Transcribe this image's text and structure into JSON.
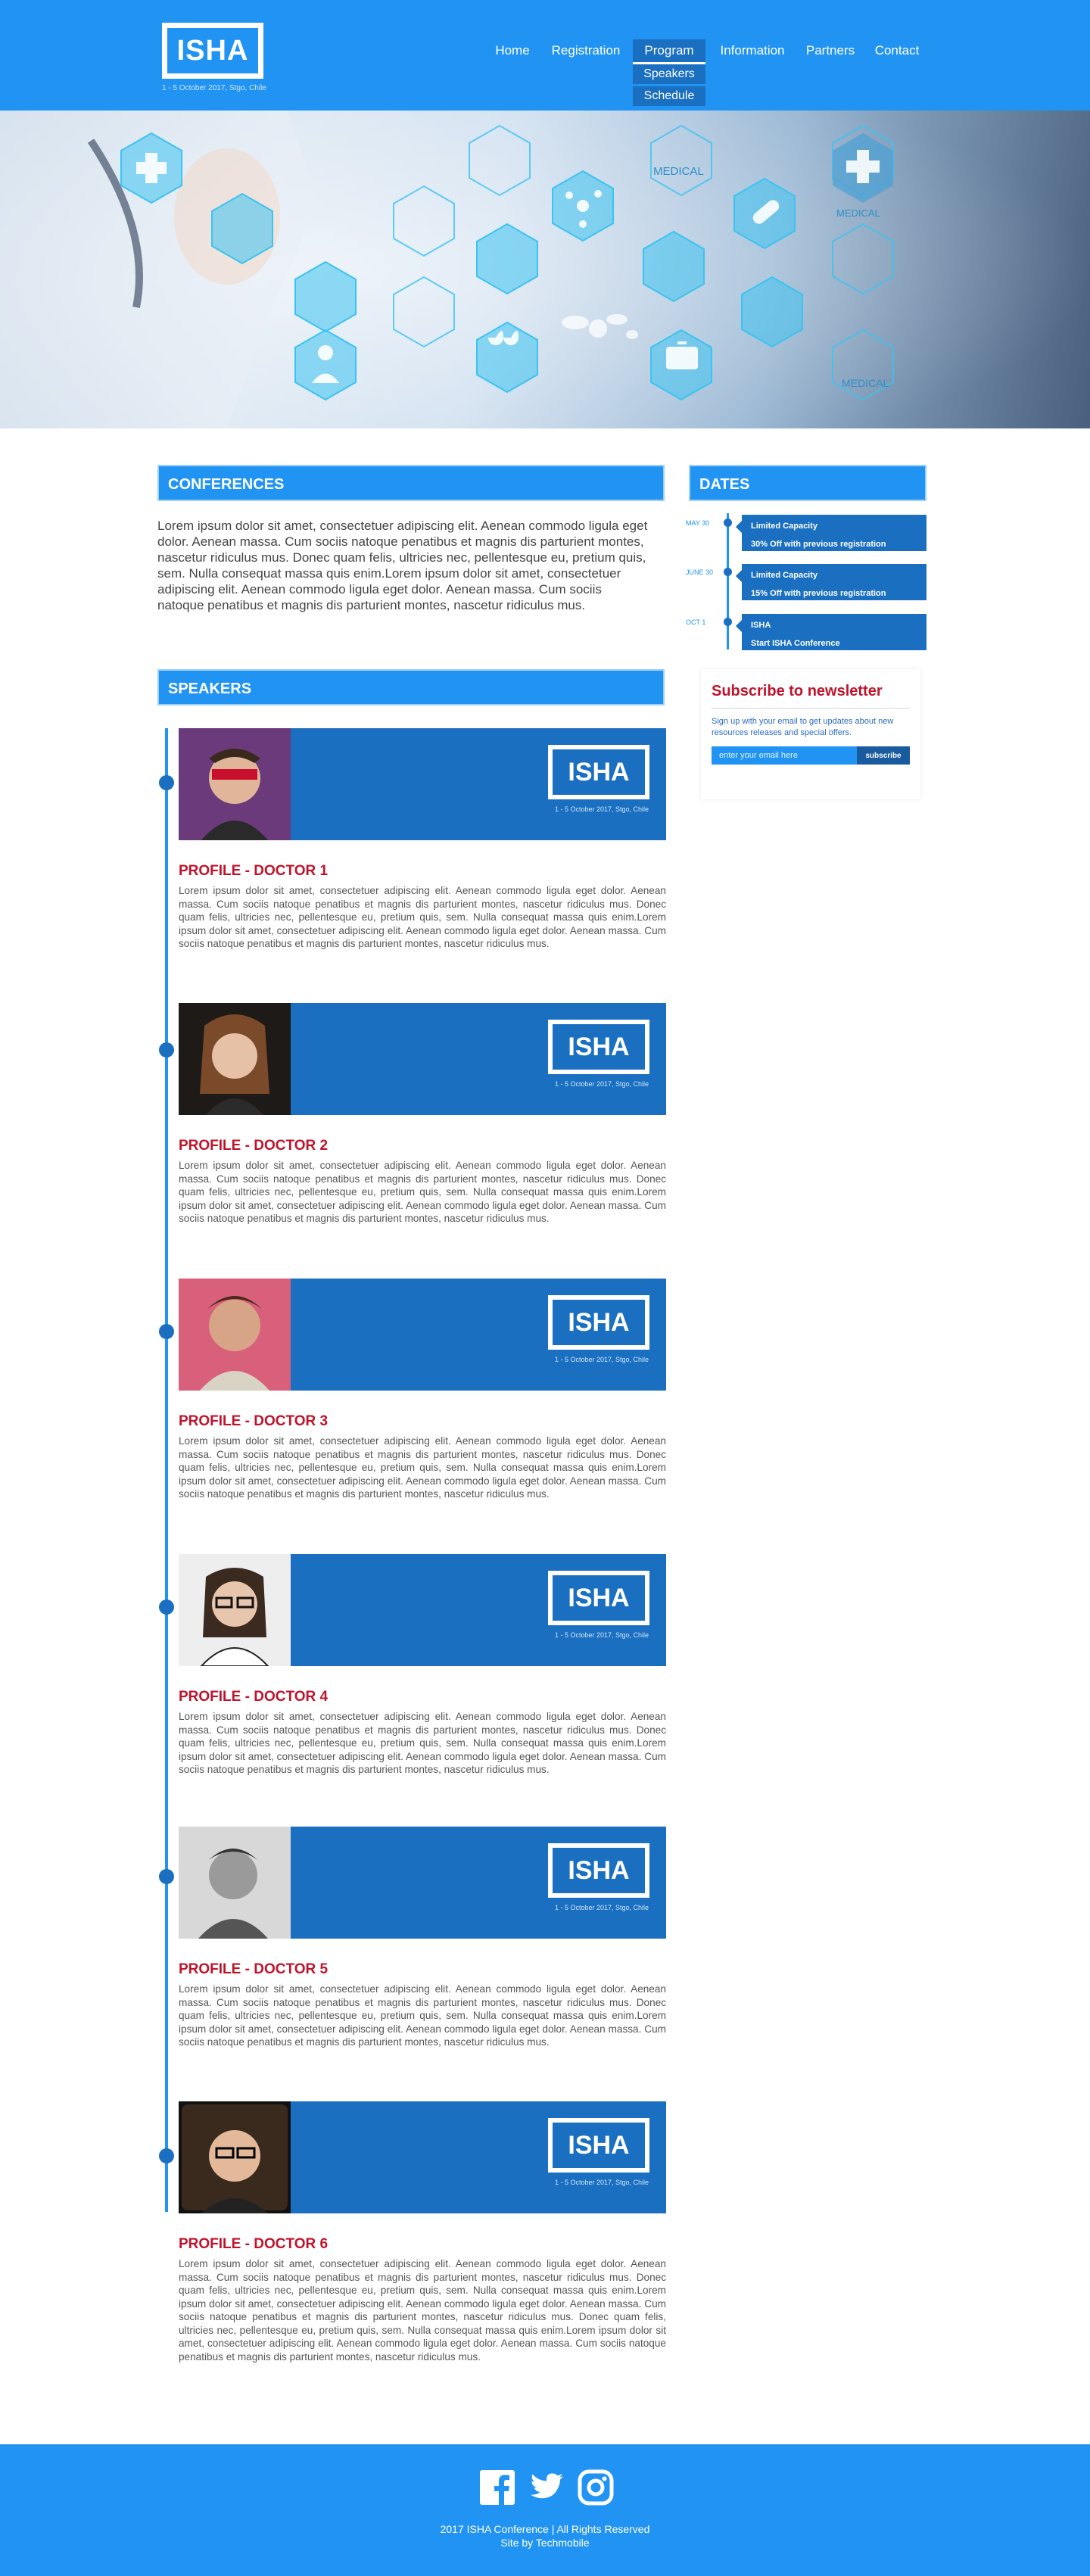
{
  "header": {
    "logo": "ISHA",
    "logo_subtitle": "1 - 5 October 2017, Stgo, Chile",
    "nav": [
      {
        "label": "Home"
      },
      {
        "label": "Registration"
      },
      {
        "label": "Program",
        "active": true
      },
      {
        "label": "Information"
      },
      {
        "label": "Partners"
      },
      {
        "label": "Contact"
      }
    ],
    "program_submenu": [
      "Speakers",
      "Schedule"
    ]
  },
  "hero": {
    "labels": [
      "MEDICAL",
      "MEDICAL",
      "MEDICAL"
    ],
    "icons": [
      "medical-cross-icon",
      "stethoscope-icon",
      "molecule-icon",
      "pill-icon",
      "test-tubes-icon",
      "microscope-icon",
      "syringe-icon",
      "first-aid-kit-icon",
      "doctor-icon",
      "wheelchair-icon",
      "blood-drops-icon",
      "world-map-icon"
    ]
  },
  "conferences": {
    "title": "CONFERENCES",
    "text": "Lorem ipsum dolor sit amet, consectetuer adipiscing elit. Aenean commodo ligula eget dolor. Aenean massa. Cum sociis natoque penatibus et magnis dis parturient montes, nascetur ridiculus mus. Donec quam felis, ultricies nec, pellentesque eu, pretium quis, sem. Nulla consequat massa quis enim.Lorem ipsum dolor sit amet, consectetuer adipiscing elit. Aenean commodo ligula eget dolor. Aenean massa. Cum sociis natoque penatibus et magnis dis parturient montes, nascetur ridiculus mus."
  },
  "dates": {
    "title": "DATES",
    "items": [
      {
        "date": "MAY 30",
        "line1": "Limited Capacity",
        "line2": "30% Off with previous registration"
      },
      {
        "date": "JUNE 30",
        "line1": "Limited Capacity",
        "line2": "15% Off with previous registration"
      },
      {
        "date": "OCT 1",
        "line1": "ISHA",
        "line2": "Start ISHA Conference"
      }
    ]
  },
  "newsletter": {
    "title": "Subscribe to newsletter",
    "description": "Sign up with your email to get updates about new resources releases and special offers.",
    "placeholder": "enter your email here",
    "button": "subscribe"
  },
  "speakers": {
    "title": "SPEAKERS",
    "banner_logo": "ISHA",
    "banner_subtitle": "1 - 5 October 2017, Stgo, Chile",
    "items": [
      {
        "name": "PROFILE - DOCTOR 1",
        "bio": "Lorem ipsum dolor sit amet, consectetuer adipiscing elit. Aenean commodo ligula eget dolor. Aenean massa. Cum sociis natoque penatibus et magnis dis parturient montes, nascetur ridiculus mus. Donec quam felis, ultricies nec, pellentesque eu, pretium quis, sem. Nulla consequat massa quis enim.Lorem ipsum dolor sit amet, consectetuer adipiscing elit. Aenean commodo ligula eget dolor. Aenean massa. Cum sociis natoque penatibus et magnis dis parturient montes, nascetur ridiculus mus."
      },
      {
        "name": "PROFILE - DOCTOR 2",
        "bio": "Lorem ipsum dolor sit amet, consectetuer adipiscing elit. Aenean commodo ligula eget dolor. Aenean massa. Cum sociis natoque penatibus et magnis dis parturient montes, nascetur ridiculus mus. Donec quam felis, ultricies nec, pellentesque eu, pretium quis, sem. Nulla consequat massa quis enim.Lorem ipsum dolor sit amet, consectetuer adipiscing elit. Aenean commodo ligula eget dolor. Aenean massa. Cum sociis natoque penatibus et magnis dis parturient montes, nascetur ridiculus mus."
      },
      {
        "name": "PROFILE - DOCTOR 3",
        "bio": "Lorem ipsum dolor sit amet, consectetuer adipiscing elit. Aenean commodo ligula eget dolor. Aenean massa. Cum sociis natoque penatibus et magnis dis parturient montes, nascetur ridiculus mus. Donec quam felis, ultricies nec, pellentesque eu, pretium quis, sem. Nulla consequat massa quis enim.Lorem ipsum dolor sit amet, consectetuer adipiscing elit. Aenean commodo ligula eget dolor. Aenean massa. Cum sociis natoque penatibus et magnis dis parturient montes, nascetur ridiculus mus."
      },
      {
        "name": "PROFILE - DOCTOR 4",
        "bio": "Lorem ipsum dolor sit amet, consectetuer adipiscing elit. Aenean commodo ligula eget dolor. Aenean massa. Cum sociis natoque penatibus et magnis dis parturient montes, nascetur ridiculus mus. Donec quam felis, ultricies nec, pellentesque eu, pretium quis, sem. Nulla consequat massa quis enim.Lorem ipsum dolor sit amet, consectetuer adipiscing elit. Aenean commodo ligula eget dolor. Aenean massa. Cum sociis natoque penatibus et magnis dis parturient montes, nascetur ridiculus mus."
      },
      {
        "name": "PROFILE - DOCTOR 5",
        "bio": "Lorem ipsum dolor sit amet, consectetuer adipiscing elit. Aenean commodo ligula eget dolor. Aenean massa. Cum sociis natoque penatibus et magnis dis parturient montes, nascetur ridiculus mus. Donec quam felis, ultricies nec, pellentesque eu, pretium quis, sem. Nulla consequat massa quis enim.Lorem ipsum dolor sit amet, consectetuer adipiscing elit. Aenean commodo ligula eget dolor. Aenean massa. Cum sociis natoque penatibus et magnis dis parturient montes, nascetur ridiculus mus."
      },
      {
        "name": "PROFILE - DOCTOR 6",
        "bio": "Lorem ipsum dolor sit amet, consectetuer adipiscing elit. Aenean commodo ligula eget dolor. Aenean massa. Cum sociis natoque penatibus et magnis dis parturient montes, nascetur ridiculus mus. Donec quam felis, ultricies nec, pellentesque eu, pretium quis, sem. Nulla consequat massa quis enim.Lorem ipsum dolor sit amet, consectetuer adipiscing elit. Aenean commodo ligula eget dolor. Aenean massa. Cum sociis natoque penatibus et magnis dis parturient montes, nascetur ridiculus mus. Donec quam felis, ultricies nec, pellentesque eu, pretium quis, sem. Nulla consequat massa quis enim.Lorem ipsum dolor sit amet, consectetuer adipiscing elit. Aenean commodo ligula eget dolor. Aenean massa. Cum sociis natoque penatibus et magnis dis parturient montes, nascetur ridiculus mus."
      }
    ]
  },
  "footer": {
    "social": [
      "facebook-icon",
      "twitter-icon",
      "instagram-icon"
    ],
    "copyright": "2017 ISHA Conference | All Rights Reserved",
    "credit": "Site by Techmobile"
  },
  "colors": {
    "brand_blue": "#2194f3",
    "dark_blue": "#1a6fc1",
    "accent_red": "#c0132b"
  }
}
